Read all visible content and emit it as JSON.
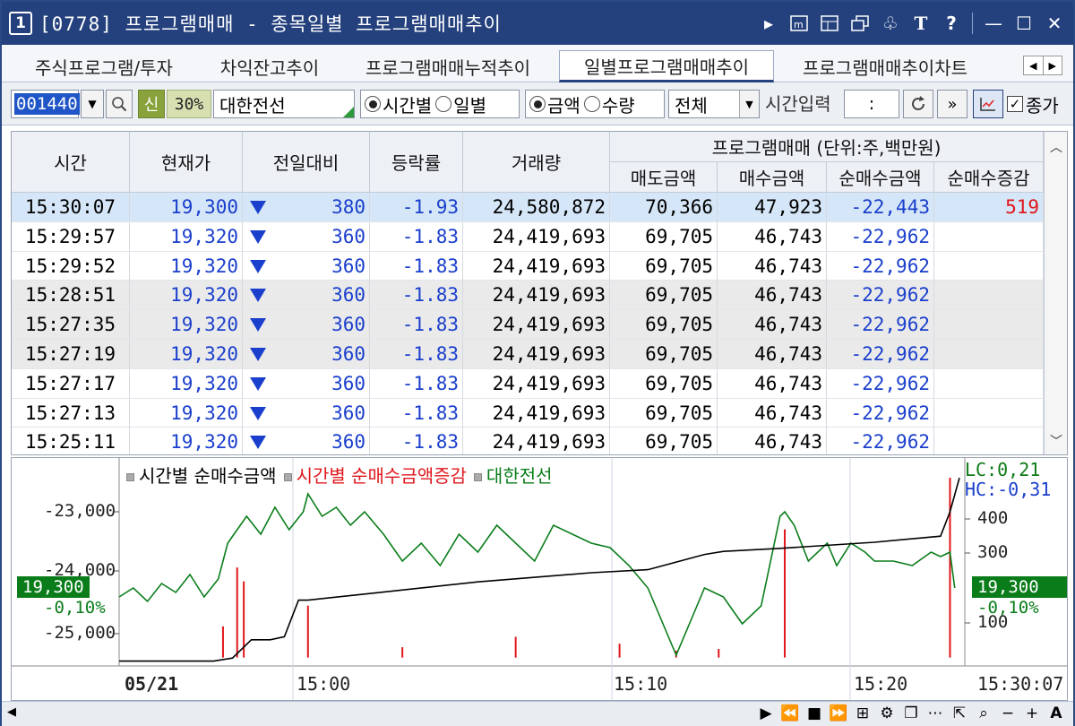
{
  "window": {
    "number": "1",
    "title": "[0778] 프로그램매매 - 종목일별 프로그램매매추이"
  },
  "tabs": [
    {
      "label": "주식프로그램/투자",
      "active": false
    },
    {
      "label": "차익잔고추이",
      "active": false
    },
    {
      "label": "프로그램매매누적추이",
      "active": false
    },
    {
      "label": "일별프로그램매매추이",
      "active": true
    },
    {
      "label": "프로그램매매추이차트",
      "active": false
    }
  ],
  "toolbar": {
    "code": "001440",
    "badge_sin": "신",
    "badge_pct": "30%",
    "stock_name": "대한전선",
    "radio_time": "시간별",
    "radio_day": "일별",
    "radio_amount": "금액",
    "radio_qty": "수량",
    "select_all": "전체",
    "time_label": "시간입력",
    "time_value": ":",
    "close_check": "종가"
  },
  "table": {
    "headers": {
      "time": "시간",
      "price": "현재가",
      "change": "전일대비",
      "rate": "등락률",
      "volume": "거래량",
      "program_group": "프로그램매매 (단위:주,백만원)",
      "sell": "매도금액",
      "buy": "매수금액",
      "net": "순매수금액",
      "net_delta": "순매수증감"
    },
    "rows": [
      {
        "time": "15:30:07",
        "price": "19,300",
        "change": "380",
        "rate": "-1.93",
        "volume": "24,580,872",
        "sell": "70,366",
        "buy": "47,923",
        "net": "-22,443",
        "net_delta": "519"
      },
      {
        "time": "15:29:57",
        "price": "19,320",
        "change": "360",
        "rate": "-1.83",
        "volume": "24,419,693",
        "sell": "69,705",
        "buy": "46,743",
        "net": "-22,962",
        "net_delta": ""
      },
      {
        "time": "15:29:52",
        "price": "19,320",
        "change": "360",
        "rate": "-1.83",
        "volume": "24,419,693",
        "sell": "69,705",
        "buy": "46,743",
        "net": "-22,962",
        "net_delta": ""
      },
      {
        "time": "15:28:51",
        "price": "19,320",
        "change": "360",
        "rate": "-1.83",
        "volume": "24,419,693",
        "sell": "69,705",
        "buy": "46,743",
        "net": "-22,962",
        "net_delta": ""
      },
      {
        "time": "15:27:35",
        "price": "19,320",
        "change": "360",
        "rate": "-1.83",
        "volume": "24,419,693",
        "sell": "69,705",
        "buy": "46,743",
        "net": "-22,962",
        "net_delta": ""
      },
      {
        "time": "15:27:19",
        "price": "19,320",
        "change": "360",
        "rate": "-1.83",
        "volume": "24,419,693",
        "sell": "69,705",
        "buy": "46,743",
        "net": "-22,962",
        "net_delta": ""
      },
      {
        "time": "15:27:17",
        "price": "19,320",
        "change": "360",
        "rate": "-1.83",
        "volume": "24,419,693",
        "sell": "69,705",
        "buy": "46,743",
        "net": "-22,962",
        "net_delta": ""
      },
      {
        "time": "15:27:13",
        "price": "19,320",
        "change": "360",
        "rate": "-1.83",
        "volume": "24,419,693",
        "sell": "69,705",
        "buy": "46,743",
        "net": "-22,962",
        "net_delta": ""
      },
      {
        "time": "15:25:11",
        "price": "19,320",
        "change": "360",
        "rate": "-1.83",
        "volume": "24,419,693",
        "sell": "69,705",
        "buy": "46,743",
        "net": "-22,962",
        "net_delta": ""
      }
    ]
  },
  "chart_data": {
    "type": "line",
    "legend": [
      "시간별 순매수금액",
      "시간별 순매수금액증감",
      "대한전선"
    ],
    "left_axis_ticks": [
      "-23,000",
      "-24,000",
      "-25,000"
    ],
    "right_axis_ticks": [
      "400",
      "300",
      "100"
    ],
    "x_labels": [
      "05/21",
      "15:00",
      "15:10",
      "15:20",
      "15:30:07"
    ],
    "lc": "LC:0,21",
    "hc": "HC:-0,31",
    "current_price": "19,300",
    "current_pct": "-0,10%",
    "series": [
      {
        "name": "시간별 순매수금액",
        "color": "#000000",
        "x": [
          0,
          100,
          120,
          140,
          160,
          175,
          190,
          200,
          260,
          380,
          500,
          560,
          620,
          640,
          700,
          800,
          870,
          880,
          890
        ],
        "values": [
          -25450,
          -25450,
          -25400,
          -25100,
          -25100,
          -25050,
          -24450,
          -24450,
          -24350,
          -24150,
          -24000,
          -23950,
          -23700,
          -23650,
          -23600,
          -23500,
          -23400,
          -23000,
          -22443
        ]
      },
      {
        "name": "시간별 순매수금액증감",
        "color": "#e0171c",
        "x": [
          110,
          125,
          132,
          200,
          300,
          420,
          530,
          590,
          635,
          705,
          880
        ],
        "values": [
          90,
          260,
          220,
          150,
          30,
          60,
          40,
          20,
          25,
          370,
          519
        ]
      },
      {
        "name": "대한전선",
        "color": "#0a7d1a",
        "x": [
          0,
          15,
          30,
          45,
          60,
          75,
          90,
          105,
          115,
          135,
          150,
          165,
          180,
          195,
          200,
          215,
          230,
          245,
          260,
          280,
          300,
          320,
          340,
          360,
          380,
          400,
          420,
          440,
          460,
          480,
          500,
          520,
          540,
          560,
          570,
          580,
          590,
          600,
          610,
          620,
          640,
          660,
          680,
          700,
          705,
          715,
          730,
          750,
          760,
          775,
          790,
          800,
          820,
          840,
          860,
          870,
          880,
          885
        ],
        "values": [
          19280,
          19300,
          19270,
          19310,
          19290,
          19330,
          19280,
          19320,
          19400,
          19460,
          19420,
          19480,
          19430,
          19470,
          19510,
          19460,
          19480,
          19440,
          19470,
          19420,
          19360,
          19400,
          19350,
          19420,
          19380,
          19440,
          19400,
          19360,
          19440,
          19420,
          19400,
          19390,
          19350,
          19300,
          19250,
          19200,
          19150,
          19200,
          19250,
          19300,
          19280,
          19220,
          19260,
          19460,
          19470,
          19440,
          19360,
          19400,
          19350,
          19400,
          19380,
          19360,
          19360,
          19350,
          19380,
          19370,
          19380,
          19300
        ]
      }
    ]
  },
  "colors": {
    "titlebar": "#24417e",
    "price_blue": "#1a3fcc",
    "delta_red": "#e0171c",
    "stock_green": "#0a7d1a",
    "selected_row": "#d4e6f7"
  }
}
